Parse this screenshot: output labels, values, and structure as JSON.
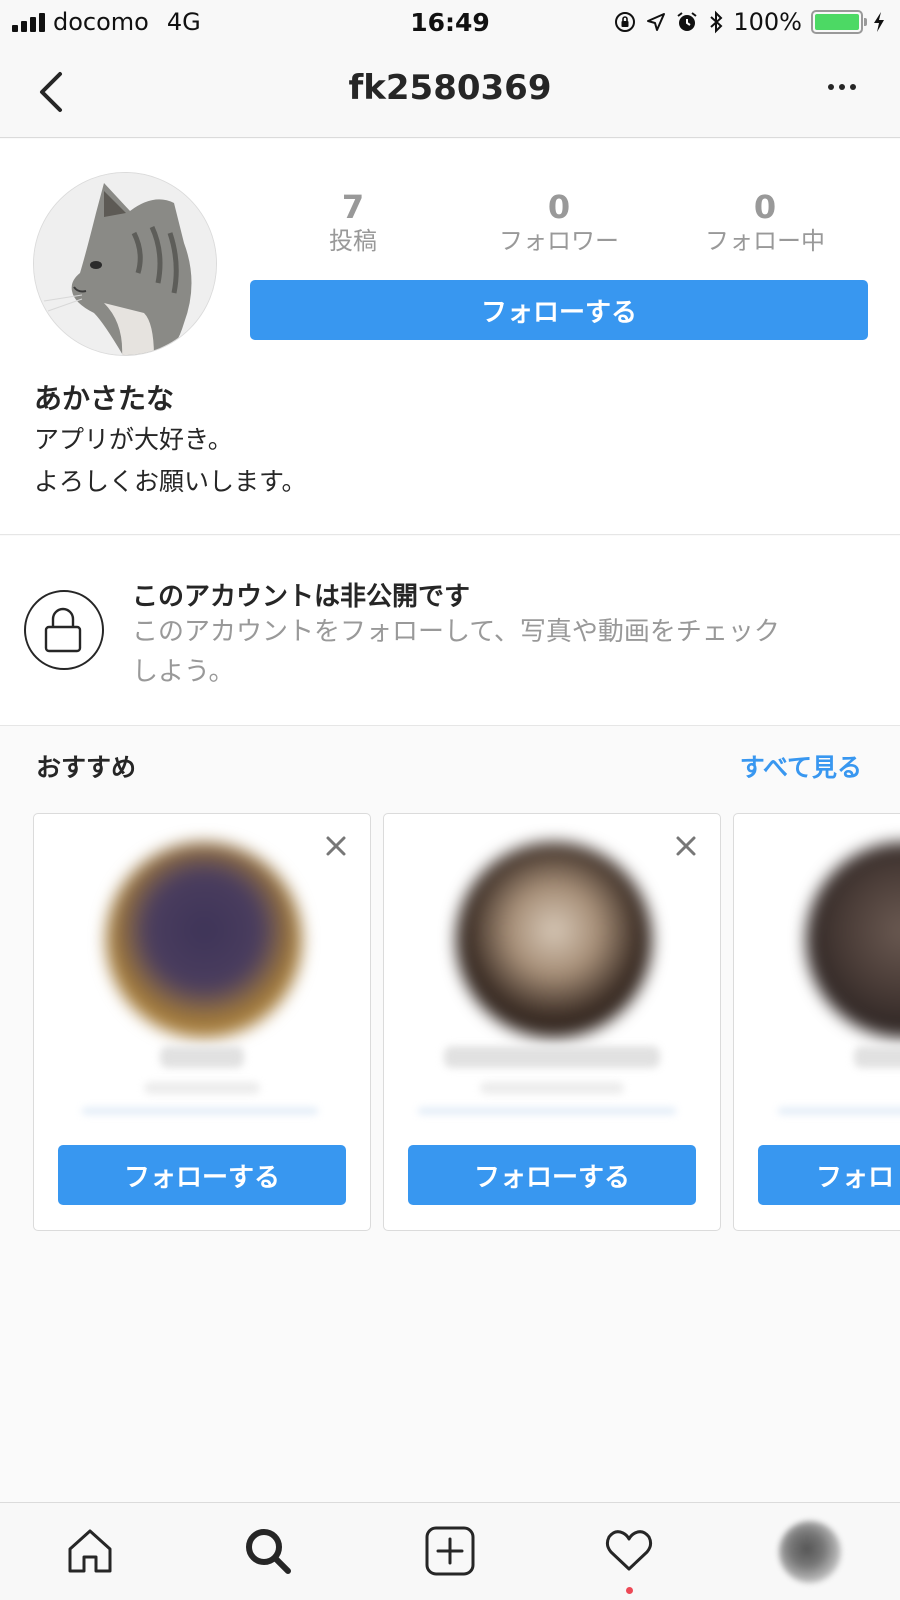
{
  "status_bar": {
    "carrier": "docomo",
    "network": "4G",
    "time": "16:49",
    "battery": "100%"
  },
  "nav": {
    "username": "fk2580369"
  },
  "profile": {
    "stats": [
      {
        "value": "7",
        "label": "投稿"
      },
      {
        "value": "0",
        "label": "フォロワー"
      },
      {
        "value": "0",
        "label": "フォロー中"
      }
    ],
    "follow_label": "フォローする",
    "display_name": "あかさたな",
    "bio_line1": "アプリが大好き。",
    "bio_line2": "よろしくお願いします。"
  },
  "private": {
    "title": "このアカウントは非公開です",
    "line1": "このアカウントをフォローして、写真や動画をチェック",
    "line2": "しよう。"
  },
  "suggestions": {
    "title": "おすすめ",
    "see_all": "すべて見る",
    "cards": [
      {
        "follow_label": "フォローする"
      },
      {
        "follow_label": "フォローする"
      },
      {
        "follow_label": "フォロ"
      }
    ]
  },
  "colors": {
    "accent": "#3897f0",
    "battery": "#4cd964",
    "notification": "#ed4956"
  },
  "icons": {
    "back": "chevron-left-icon",
    "more": "more-icon",
    "lock": "lock-icon",
    "close": "close-icon",
    "home": "home-icon",
    "search": "search-icon",
    "add": "add-icon",
    "activity": "heart-icon"
  }
}
